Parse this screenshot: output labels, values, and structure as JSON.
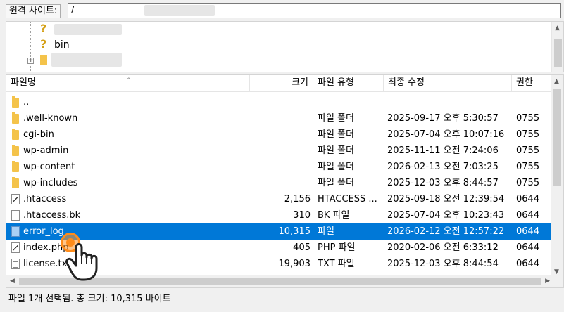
{
  "address_bar": {
    "label": "원격 사이트:",
    "value": "/"
  },
  "tree": {
    "items": [
      {
        "label": "",
        "icon": "question-folder-icon"
      },
      {
        "label": "bin",
        "icon": "question-folder-icon"
      },
      {
        "label": "",
        "icon": "folder-icon"
      }
    ]
  },
  "list": {
    "columns": {
      "name": "파일명",
      "size": "크기",
      "type": "파일 유형",
      "modified": "최종 수정",
      "perm": "권한"
    },
    "rows": [
      {
        "name": "..",
        "size": "",
        "type": "",
        "modified": "",
        "perm": "",
        "icon": "folder-icon"
      },
      {
        "name": ".well-known",
        "size": "",
        "type": "파일 폴더",
        "modified": "2025-09-17 오후 5:30:57",
        "perm": "0755",
        "icon": "folder-icon"
      },
      {
        "name": "cgi-bin",
        "size": "",
        "type": "파일 폴더",
        "modified": "2025-07-04 오후 10:07:16",
        "perm": "0755",
        "icon": "folder-icon"
      },
      {
        "name": "wp-admin",
        "size": "",
        "type": "파일 폴더",
        "modified": "2025-11-11 오전 7:24:06",
        "perm": "0755",
        "icon": "folder-icon"
      },
      {
        "name": "wp-content",
        "size": "",
        "type": "파일 폴더",
        "modified": "2026-02-13 오전 7:03:25",
        "perm": "0755",
        "icon": "folder-icon"
      },
      {
        "name": "wp-includes",
        "size": "",
        "type": "파일 폴더",
        "modified": "2025-12-03 오후 8:44:57",
        "perm": "0755",
        "icon": "folder-icon"
      },
      {
        "name": ".htaccess",
        "size": "2,156",
        "type": "HTACCESS ...",
        "modified": "2025-09-18 오전 12:39:54",
        "perm": "0644",
        "icon": "config-file-icon"
      },
      {
        "name": ".htaccess.bk",
        "size": "310",
        "type": "BK 파일",
        "modified": "2025-07-04 오후 10:23:43",
        "perm": "0644",
        "icon": "file-icon"
      },
      {
        "name": "error_log",
        "size": "10,315",
        "type": "파일",
        "modified": "2026-02-12 오전 12:57:22",
        "perm": "0644",
        "icon": "file-icon",
        "selected": true
      },
      {
        "name": "index.php",
        "size": "405",
        "type": "PHP 파일",
        "modified": "2020-02-06 오전 6:33:12",
        "perm": "0644",
        "icon": "php-file-icon"
      },
      {
        "name": "license.txt",
        "size": "19,903",
        "type": "TXT 파일",
        "modified": "2025-12-03 오후 8:44:54",
        "perm": "0644",
        "icon": "text-file-icon"
      }
    ]
  },
  "status": {
    "text": "파일 1개 선택됨. 총 크기: 10,315 바이트"
  },
  "colors": {
    "selection": "#0078d7",
    "folder": "#f4c34a",
    "click_marker": "#ff8c1a"
  }
}
